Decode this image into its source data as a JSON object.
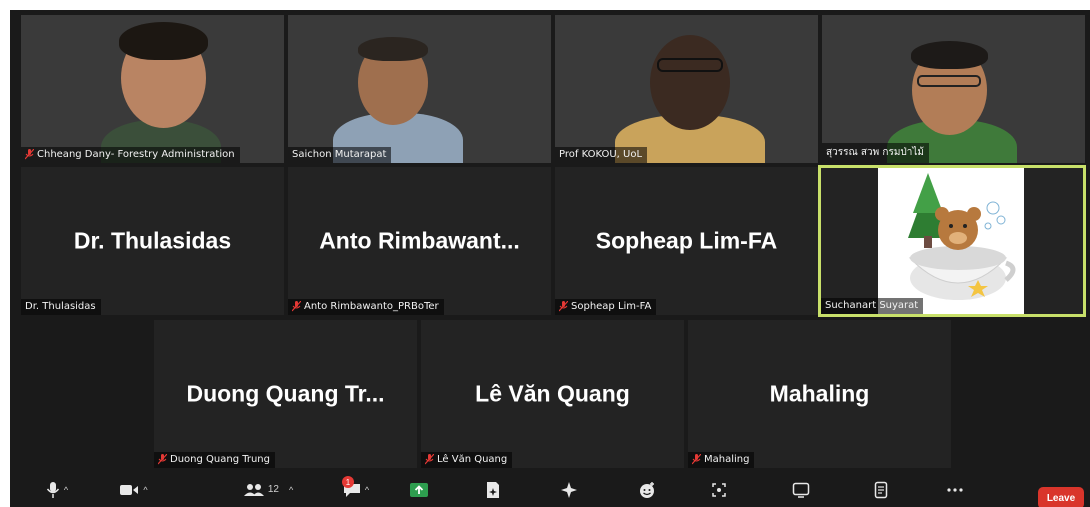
{
  "participants": [
    {
      "name": "Chheang Dany- Forestry Administration",
      "muted": true
    },
    {
      "name": "Saichon Mutarapat",
      "muted": false
    },
    {
      "name": "Prof KOKOU, UoL",
      "muted": false
    },
    {
      "name": "สุวรรณ สวพ กรมป่าไม้",
      "muted": false
    },
    {
      "name": "Dr. Thulasidas",
      "display": "Dr. Thulasidas",
      "muted": false
    },
    {
      "name": "Anto Rimbawanto_PRBoTer",
      "display": "Anto  Rimbawant...",
      "muted": true
    },
    {
      "name": "Sopheap Lim-FA",
      "display": "Sopheap Lim-FA",
      "muted": true
    },
    {
      "name": "Suchanart Suyarat",
      "muted": false
    },
    {
      "name": "Duong Quang Trung",
      "display": "Duong  Quang  Tr...",
      "muted": true
    },
    {
      "name": "Lê Văn Quang",
      "display": "Lê Văn Quang",
      "muted": true
    },
    {
      "name": "Mahaling",
      "display": "Mahaling",
      "muted": true
    }
  ],
  "toolbar": {
    "participants_count": "12",
    "chat_badge": "1",
    "leave_label": "Leave",
    "icons": [
      "microphone-icon",
      "video-camera-icon",
      "participants-icon",
      "chat-icon",
      "share-screen-icon",
      "summary-icon",
      "ai-companion-icon",
      "reactions-icon",
      "apps-icon",
      "whiteboards-icon",
      "notes-icon",
      "more-icon"
    ]
  },
  "colors": {
    "background": "#1a1a1a",
    "tile": "#232323",
    "active_speaker_border": "#c8e06a",
    "muted_red": "#e53935",
    "leave_red": "#d9352b"
  }
}
